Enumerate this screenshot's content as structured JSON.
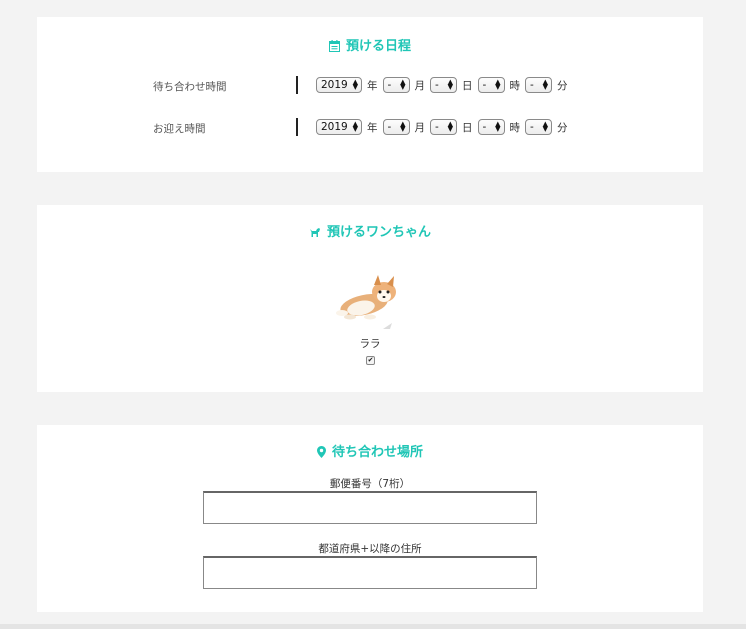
{
  "schedule": {
    "title": "預ける日程",
    "rows": [
      {
        "label": "待ち合わせ時間",
        "year": "2019",
        "month": "-",
        "day": "-",
        "hour": "-",
        "minute": "-"
      },
      {
        "label": "お迎え時間",
        "year": "2019",
        "month": "-",
        "day": "-",
        "hour": "-",
        "minute": "-"
      }
    ],
    "units": {
      "year": "年",
      "month": "月",
      "day": "日",
      "hour": "時",
      "minute": "分"
    }
  },
  "dogs": {
    "title": "預けるワンちゃん",
    "items": [
      {
        "name": "ララ",
        "checked": true
      }
    ]
  },
  "place": {
    "title": "待ち合わせ場所",
    "postal_label": "郵便番号（7桁）",
    "postal_value": "",
    "address_label": "都道府県+以降の住所",
    "address_value": ""
  },
  "colors": {
    "accent": "#20c6b6",
    "background": "#f3f3f3"
  },
  "icons": {
    "schedule": "calendar-icon",
    "dogs": "dog-icon",
    "place": "map-pin-icon"
  }
}
